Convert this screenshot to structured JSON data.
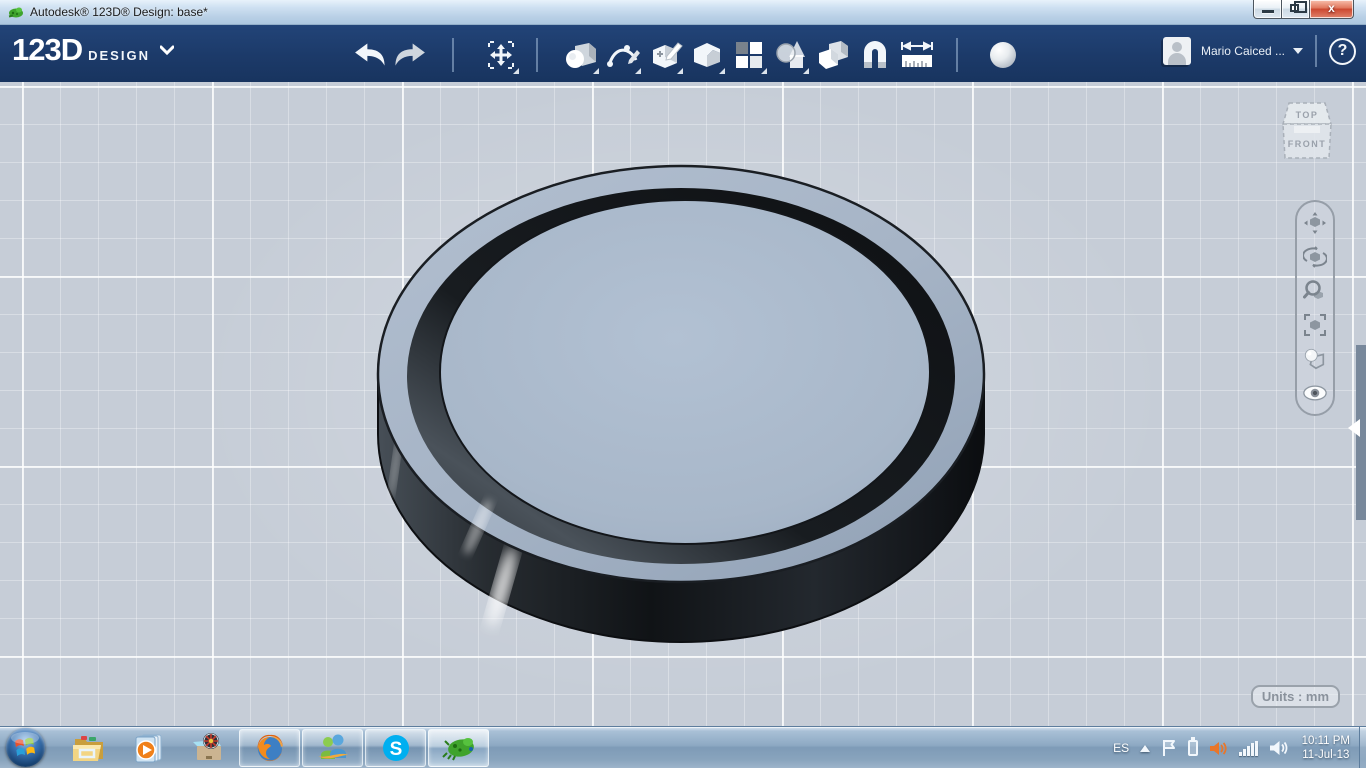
{
  "window": {
    "title": "Autodesk® 123D® Design: base*"
  },
  "appbar": {
    "brand": "123D",
    "brand_sub": "DESIGN",
    "user_name": "Mario Caiced ...",
    "help_glyph": "?",
    "tools": [
      "undo",
      "redo",
      "transform",
      "primitives",
      "sketch",
      "construct",
      "modify",
      "pattern",
      "grouping",
      "combine",
      "snap",
      "measure",
      "material"
    ]
  },
  "viewport": {
    "viewcube_top": "TOP",
    "viewcube_front": "FRONT",
    "units": "Units : mm",
    "nav_icons": [
      "pan",
      "orbit",
      "zoom",
      "fit",
      "display",
      "visibility"
    ],
    "model": "circular base: outer ring with recessed inner disc, steel-blue top faces, dark charcoal sides"
  },
  "taskbar": {
    "apps": [
      "start",
      "windows-explorer",
      "windows-media-player",
      "box-app",
      "firefox",
      "windows-live-messenger",
      "skype",
      "123d-design"
    ],
    "active_app": "123d-design"
  },
  "tray": {
    "language": "ES",
    "time": "10:11 PM",
    "date": "11-Jul-13"
  },
  "colors": {
    "appbar_navy": "#1c3a69",
    "viewport_bg": "#c6cdd7",
    "model_top": "#a9b6c7",
    "model_side_dark": "#16191d",
    "groove": "#2e343a",
    "close_red": "#cc4830",
    "taskbar_glass": "#8da9c3",
    "side_tab_slate": "#78889b"
  }
}
